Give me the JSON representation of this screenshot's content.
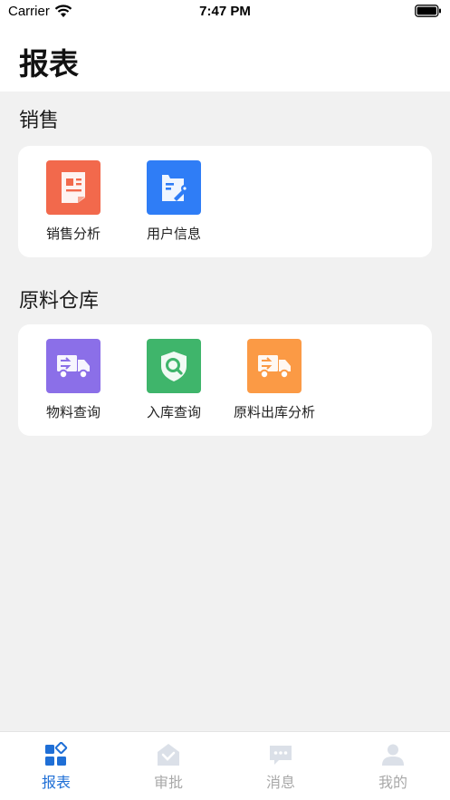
{
  "status_bar": {
    "carrier": "Carrier",
    "time": "7:47 PM"
  },
  "header": {
    "title": "报表"
  },
  "sections": [
    {
      "title": "销售",
      "items": [
        {
          "label": "销售分析",
          "icon": "report-document-icon",
          "color": "#f2694c"
        },
        {
          "label": "用户信息",
          "icon": "user-info-edit-icon",
          "color": "#2f7df6"
        }
      ]
    },
    {
      "title": "原料仓库",
      "items": [
        {
          "label": "物料查询",
          "icon": "delivery-truck-icon",
          "color": "#8b6fe8"
        },
        {
          "label": "入库查询",
          "icon": "shield-search-icon",
          "color": "#3fb56b"
        },
        {
          "label": "原料出库分析",
          "icon": "delivery-truck-icon",
          "color": "#fb9a45"
        }
      ]
    }
  ],
  "tab_bar": {
    "tabs": [
      {
        "label": "报表",
        "icon": "grid-apps-icon",
        "active": true
      },
      {
        "label": "审批",
        "icon": "approval-inbox-icon",
        "active": false
      },
      {
        "label": "消息",
        "icon": "message-chat-icon",
        "active": false
      },
      {
        "label": "我的",
        "icon": "user-profile-icon",
        "active": false
      }
    ],
    "active_color": "#1f6fd6",
    "inactive_color": "#a8a8a8"
  }
}
